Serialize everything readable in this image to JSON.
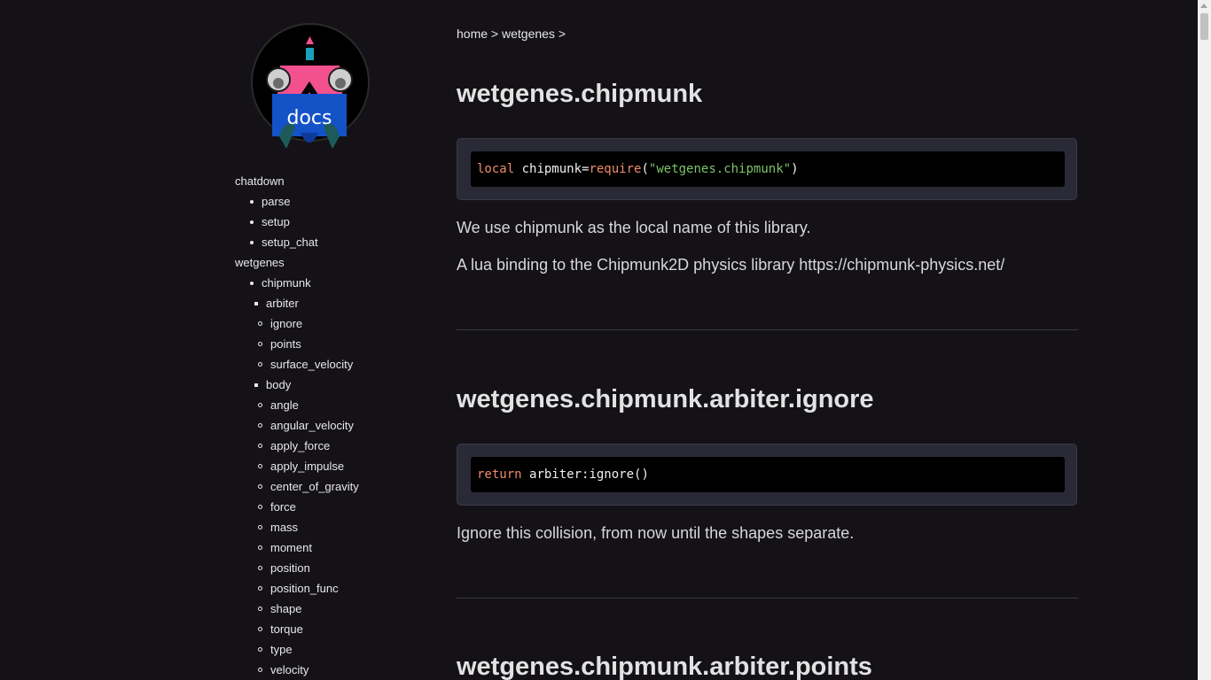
{
  "logo": {
    "text": "docs"
  },
  "sidebar": {
    "items": [
      {
        "label": "chatdown",
        "level": 0
      },
      {
        "label": "parse",
        "level": 1
      },
      {
        "label": "setup",
        "level": 1
      },
      {
        "label": "setup_chat",
        "level": 1
      },
      {
        "label": "wetgenes",
        "level": 0
      },
      {
        "label": "chipmunk",
        "level": 1
      },
      {
        "label": "arbiter",
        "level": 2
      },
      {
        "label": "ignore",
        "level": 3
      },
      {
        "label": "points",
        "level": 3
      },
      {
        "label": "surface_velocity",
        "level": 3
      },
      {
        "label": "body",
        "level": 2
      },
      {
        "label": "angle",
        "level": 3
      },
      {
        "label": "angular_velocity",
        "level": 3
      },
      {
        "label": "apply_force",
        "level": 3
      },
      {
        "label": "apply_impulse",
        "level": 3
      },
      {
        "label": "center_of_gravity",
        "level": 3
      },
      {
        "label": "force",
        "level": 3
      },
      {
        "label": "mass",
        "level": 3
      },
      {
        "label": "moment",
        "level": 3
      },
      {
        "label": "position",
        "level": 3
      },
      {
        "label": "position_func",
        "level": 3
      },
      {
        "label": "shape",
        "level": 3
      },
      {
        "label": "torque",
        "level": 3
      },
      {
        "label": "type",
        "level": 3
      },
      {
        "label": "velocity",
        "level": 3
      }
    ]
  },
  "breadcrumb": {
    "home": "home",
    "sep1": " > ",
    "wetgenes": "wetgenes",
    "sep2": " >"
  },
  "sections": [
    {
      "title": "wetgenes.chipmunk",
      "code": {
        "kw": "local",
        "sp": " ",
        "ident": "chipmunk=",
        "fn": "require",
        "open": "(",
        "str": "\"wetgenes.chipmunk\"",
        "close": ")"
      },
      "paragraphs": [
        "We use chipmunk as the local name of this library.",
        "A lua binding to the Chipmunk2D physics library https://chipmunk-physics.net/"
      ]
    },
    {
      "title": "wetgenes.chipmunk.arbiter.ignore",
      "code": {
        "kw": "return",
        "sp": " ",
        "ident": "arbiter:ignore()"
      },
      "paragraphs": [
        "Ignore this collision, from now until the shapes separate."
      ]
    },
    {
      "title": "wetgenes.chipmunk.arbiter.points"
    }
  ],
  "colors": {
    "background": "#141216",
    "code_frame": "#2a2a36",
    "keyword": "#f08a69",
    "string": "#7cc46a",
    "logo_pink": "#f2508e",
    "logo_blue": "#1452c8"
  }
}
